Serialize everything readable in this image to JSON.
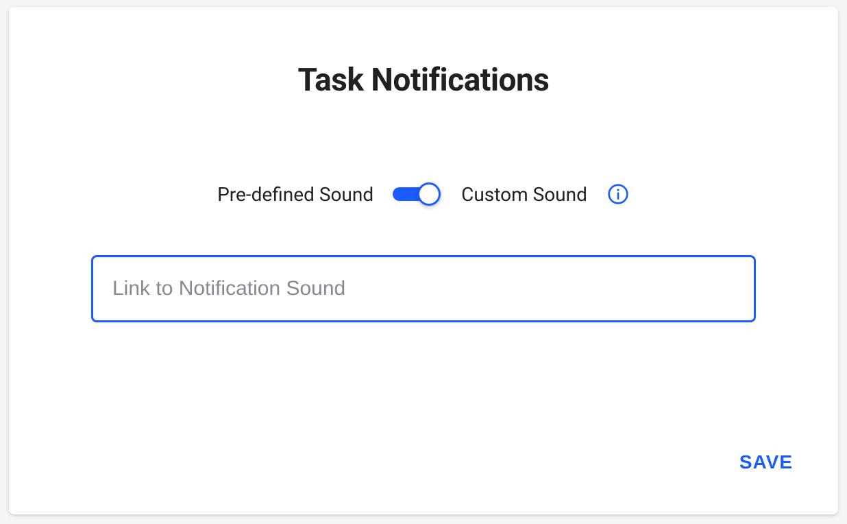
{
  "title": "Task Notifications",
  "toggle": {
    "left_label": "Pre-defined Sound",
    "right_label": "Custom Sound",
    "state": "on"
  },
  "sound_input": {
    "placeholder": "Link to Notification Sound",
    "value": ""
  },
  "actions": {
    "save_label": "SAVE"
  },
  "colors": {
    "accent": "#1a5cff",
    "text": "#202124",
    "placeholder": "#838891"
  }
}
